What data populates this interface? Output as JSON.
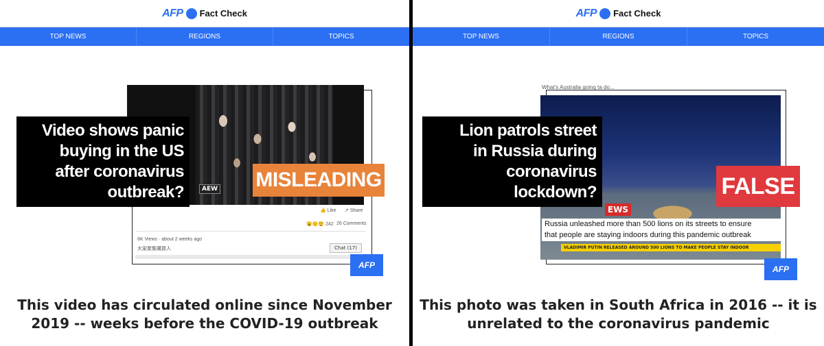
{
  "panels": [
    {
      "header": {
        "logo": "AFP",
        "title": "Fact Check"
      },
      "nav": [
        "TOP NEWS",
        "REGIONS",
        "TOPICS"
      ],
      "claim_lines": [
        "Video shows panic",
        "buying in the US",
        "after coronavirus",
        "outbreak?"
      ],
      "verdict": "MISLEADING",
      "post": {
        "watermark": "AEW",
        "like": "Like",
        "share": "Share",
        "reaction_count": "242",
        "comments": "26 Comments",
        "views": "6K Views · about 2 weeks ago",
        "comment_text": "大家聚集購買人",
        "chat": "Chat (17)"
      },
      "badge": "AFP",
      "caption_lines": [
        "This video has circulated online since November",
        "2019 -- weeks before the COVID-19 outbreak"
      ]
    },
    {
      "header": {
        "logo": "AFP",
        "title": "Fact Check"
      },
      "nav": [
        "TOP NEWS",
        "REGIONS",
        "TOPICS"
      ],
      "claim_lines": [
        "Lion patrols street",
        "in Russia during",
        "coronavirus",
        "lockdown?"
      ],
      "verdict": "FALSE",
      "post": {
        "top_text": "What's Australia going ta do...",
        "news_tag": "EWS",
        "ticker_1": "Russia unleashed more than 500 lions on its streets to ensure",
        "ticker_2": "that people are staying indoors during this pandemic outbreak",
        "ticker_3": "VLADIMIR PUTIN RELEASED AROUND 500 LIONS TO MAKE PEOPLE STAY INDOOR"
      },
      "badge": "AFP",
      "caption_lines": [
        "This photo was taken in South Africa in 2016 -- it is",
        "unrelated to the coronavirus pandemic"
      ]
    }
  ],
  "colors": {
    "brand_blue": "#2b6ff3",
    "misleading_orange": "#e8833a",
    "false_red": "#e0393e"
  }
}
